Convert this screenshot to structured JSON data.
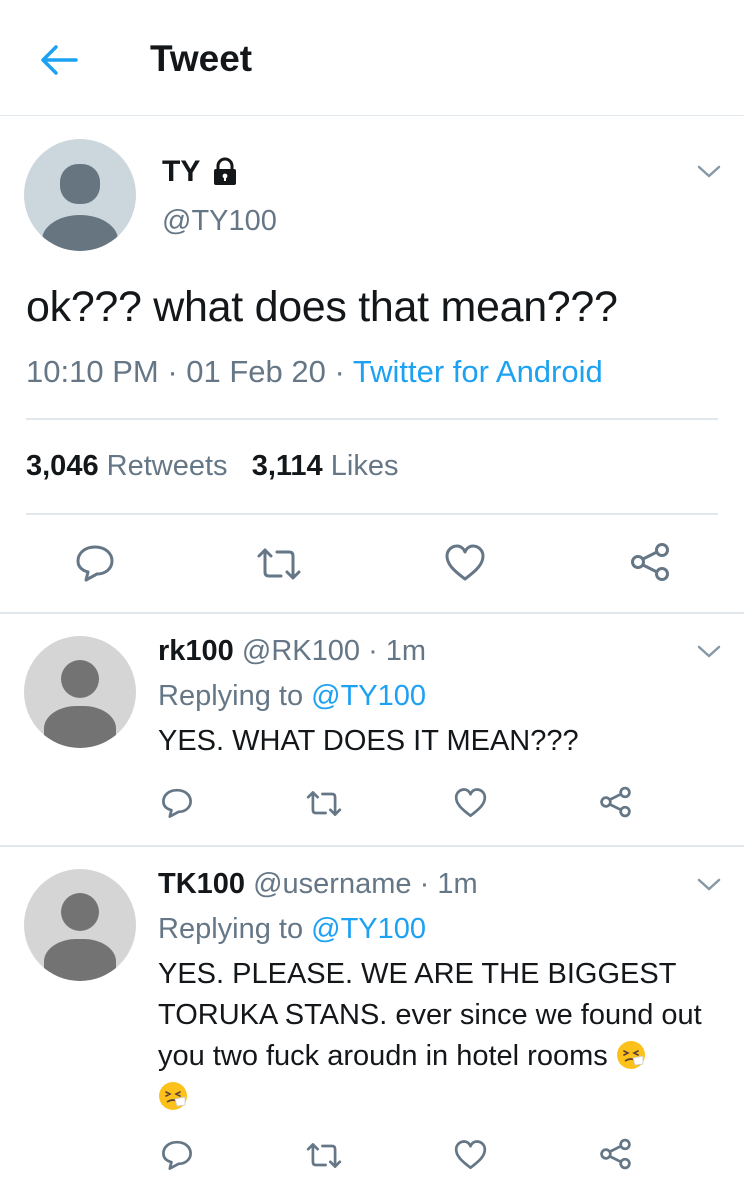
{
  "header": {
    "title": "Tweet",
    "back_icon": "arrow-left-icon"
  },
  "tweet": {
    "author_name": "TY",
    "author_handle": "@TY100",
    "protected_icon": "lock-icon",
    "text": "ok??? what does that mean???",
    "time": "10:10 PM",
    "date": "01 Feb 20",
    "source": "Twitter for Android",
    "retweets_count": "3,046",
    "retweets_label": "Retweets",
    "likes_count": "3,114",
    "likes_label": "Likes"
  },
  "replies": [
    {
      "name": "rk100",
      "handle": "@RK100",
      "time": "1m",
      "replying_label": "Replying to",
      "replying_to": "@TY100",
      "text": "YES. WHAT DOES IT MEAN???"
    },
    {
      "name": "TK100",
      "handle": "@username",
      "time": "1m",
      "replying_label": "Replying to",
      "replying_to": "@TY100",
      "text_line1": "YES. PLEASE. WE ARE THE BIGGEST",
      "text_line2": "TORUKA STANS. ever since we found out",
      "text_line3": "you two fuck aroudn in hotel rooms",
      "emoji": "sneezing-face-emoji"
    }
  ],
  "separator": "·",
  "colors": {
    "accent": "#1da1f2",
    "text": "#14171a",
    "muted": "#657786",
    "divider": "#e1e8ed"
  }
}
